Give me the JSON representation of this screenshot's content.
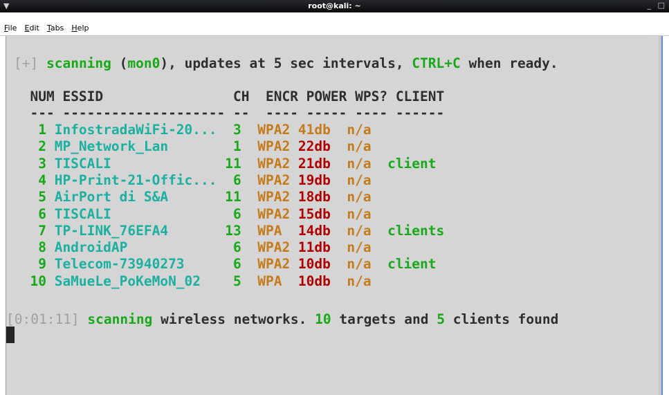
{
  "window": {
    "title": "root@kali: ~",
    "app_icon": "terminal-icon",
    "controls": [
      "_",
      "□"
    ]
  },
  "menu": [
    "File",
    "Edit",
    "Tabs",
    "Help"
  ],
  "status_line": {
    "bracket": "[+]",
    "word1": "scanning",
    "paren_open": " (",
    "iface": "mon0",
    "rest1": "), updates at 5 sec intervals, ",
    "ctrl": "CTRL+C",
    "rest2": " when ready."
  },
  "table": {
    "headers": [
      "NUM",
      "ESSID",
      "CH",
      "ENCR",
      "POWER",
      "WPS?",
      "CLIENT"
    ],
    "separators": [
      "---",
      "--------------------",
      "--",
      "----",
      "-----",
      "----",
      "------"
    ],
    "rows": [
      {
        "num": "1",
        "essid": "InfostradaWiFi-20...",
        "ch": "3",
        "encr": "WPA2",
        "power": "41db",
        "wps": "n/a",
        "client": ""
      },
      {
        "num": "2",
        "essid": "MP_Network_Lan",
        "ch": "1",
        "encr": "WPA2",
        "power": "22db",
        "wps": "n/a",
        "client": ""
      },
      {
        "num": "3",
        "essid": "TISCALI",
        "ch": "11",
        "encr": "WPA2",
        "power": "21db",
        "wps": "n/a",
        "client": "client"
      },
      {
        "num": "4",
        "essid": "HP-Print-21-Offic...",
        "ch": "6",
        "encr": "WPA2",
        "power": "19db",
        "wps": "n/a",
        "client": ""
      },
      {
        "num": "5",
        "essid": "AirPort di S&A",
        "ch": "11",
        "encr": "WPA2",
        "power": "18db",
        "wps": "n/a",
        "client": ""
      },
      {
        "num": "6",
        "essid": "TISCALI",
        "ch": "6",
        "encr": "WPA2",
        "power": "15db",
        "wps": "n/a",
        "client": ""
      },
      {
        "num": "7",
        "essid": "TP-LINK_76EFA4",
        "ch": "13",
        "encr": "WPA",
        "power": "14db",
        "wps": "n/a",
        "client": "clients"
      },
      {
        "num": "8",
        "essid": "AndroidAP",
        "ch": "6",
        "encr": "WPA2",
        "power": "11db",
        "wps": "n/a",
        "client": ""
      },
      {
        "num": "9",
        "essid": "Telecom-73940273",
        "ch": "6",
        "encr": "WPA2",
        "power": "10db",
        "wps": "n/a",
        "client": "client"
      },
      {
        "num": "10",
        "essid": "SaMueLe_PoKeMoN_02",
        "ch": "5",
        "encr": "WPA",
        "power": "10db",
        "wps": "n/a",
        "client": ""
      }
    ]
  },
  "footer_line": {
    "timer": "[0:01:11]",
    "word1": "scanning",
    "rest1": " wireless networks. ",
    "targets": "10",
    "rest2": " targets and ",
    "clients": "5",
    "rest3": " clients found"
  },
  "colors": {
    "green": "#18a818",
    "cyan": "#1cb0a0",
    "orange": "#c57b1a",
    "red": "#b00000",
    "background": "#d5d5d5"
  }
}
